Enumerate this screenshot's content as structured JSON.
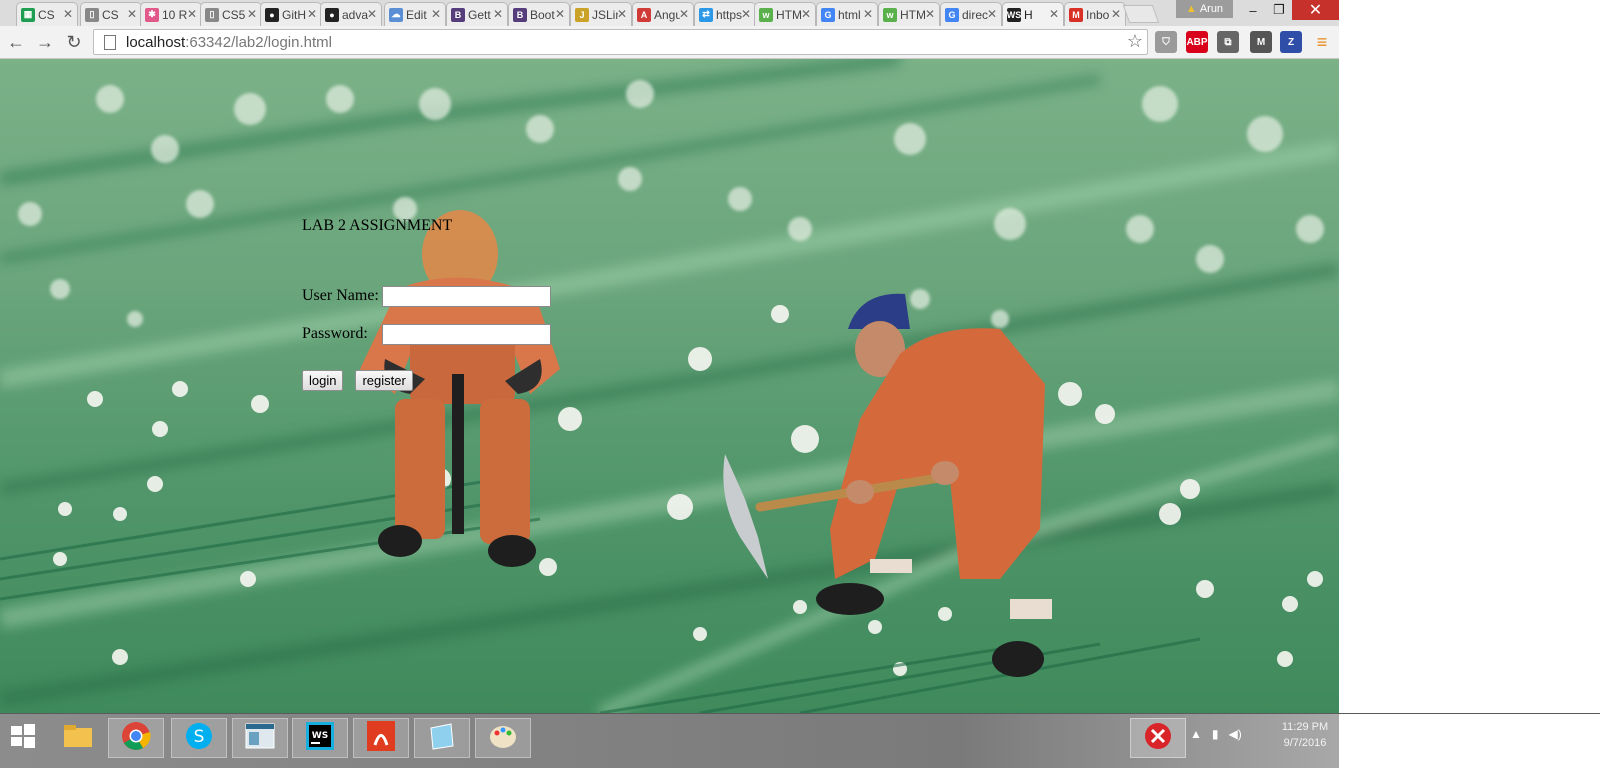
{
  "browser": {
    "tabs": [
      {
        "label": "CS",
        "color": "#1e9e53",
        "glyph": "▦"
      },
      {
        "label": "CS",
        "color": "#888888",
        "glyph": "▯"
      },
      {
        "label": "10 R",
        "color": "#e2588a",
        "glyph": "✱"
      },
      {
        "label": "CS5",
        "color": "#888888",
        "glyph": "▯"
      },
      {
        "label": "GitH",
        "color": "#222222",
        "glyph": "●"
      },
      {
        "label": "adva",
        "color": "#222222",
        "glyph": "●"
      },
      {
        "label": "Edit",
        "color": "#5a8fd6",
        "glyph": "☁"
      },
      {
        "label": "Gett",
        "color": "#563d7c",
        "glyph": "B"
      },
      {
        "label": "Boot",
        "color": "#563d7c",
        "glyph": "B"
      },
      {
        "label": "JSLin",
        "color": "#c9a227",
        "glyph": "J"
      },
      {
        "label": "Angu",
        "color": "#d03b37",
        "glyph": "A"
      },
      {
        "label": "https",
        "color": "#2b98e8",
        "glyph": "⇄"
      },
      {
        "label": "HTM",
        "color": "#5ab04a",
        "glyph": "w"
      },
      {
        "label": "html",
        "color": "#4285f4",
        "glyph": "G"
      },
      {
        "label": "HTM",
        "color": "#5ab04a",
        "glyph": "w"
      },
      {
        "label": "direc",
        "color": "#4285f4",
        "glyph": "G"
      },
      {
        "label": "H",
        "color": "#222222",
        "glyph": "WS",
        "active": true
      },
      {
        "label": "Inbo",
        "color": "#d93025",
        "glyph": "M"
      }
    ],
    "profile_name": "Arun",
    "url_host": "localhost",
    "url_rest": ":63342/lab2/login.html",
    "extensions": [
      {
        "name": "shield",
        "color": "#9a9a9a",
        "text": "⛉"
      },
      {
        "name": "adblock-plus",
        "color": "#d8001a",
        "text": "ABP"
      },
      {
        "name": "cast",
        "color": "#666666",
        "text": "⧉"
      },
      {
        "name": "vault",
        "color": "#555555",
        "text": "M"
      },
      {
        "name": "zotero",
        "color": "#2f4ea8",
        "text": "Z"
      }
    ]
  },
  "page": {
    "heading": "LAB 2 ASSIGNMENT",
    "username_label": "User Name:",
    "password_label": "Password:",
    "username_value": "",
    "password_value": "",
    "login_label": "login",
    "register_label": "register"
  },
  "taskbar": {
    "apps": [
      {
        "name": "start",
        "boxed": false
      },
      {
        "name": "file-explorer",
        "boxed": false
      },
      {
        "name": "chrome",
        "boxed": true
      },
      {
        "name": "skype",
        "boxed": true
      },
      {
        "name": "window-app",
        "boxed": true
      },
      {
        "name": "webstorm",
        "boxed": true
      },
      {
        "name": "acrobat",
        "boxed": true
      },
      {
        "name": "notepad",
        "boxed": true
      },
      {
        "name": "paint",
        "boxed": true
      }
    ],
    "time": "11:29 PM",
    "date": "9/7/2016"
  }
}
